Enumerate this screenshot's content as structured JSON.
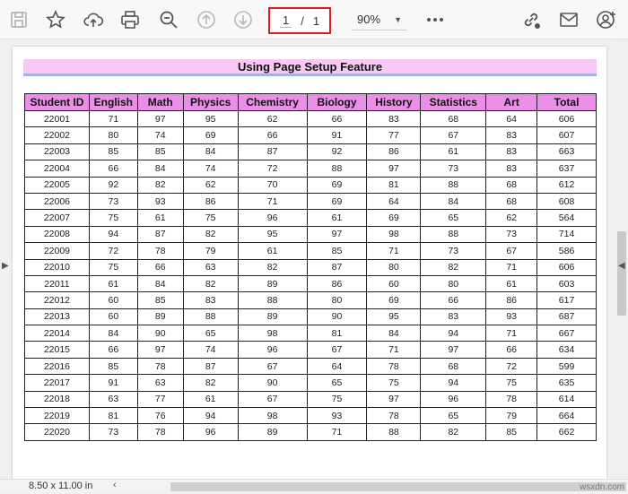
{
  "toolbar": {
    "current_page": "1",
    "page_separator": "/",
    "total_pages": "1",
    "zoom": "90%"
  },
  "document": {
    "title": "Using Page Setup Feature",
    "headers": [
      "Student ID",
      "English",
      "Math",
      "Physics",
      "Chemistry",
      "Biology",
      "History",
      "Statistics",
      "Art",
      "Total"
    ],
    "rows": [
      [
        "22001",
        "71",
        "97",
        "95",
        "62",
        "66",
        "83",
        "68",
        "64",
        "606"
      ],
      [
        "22002",
        "80",
        "74",
        "69",
        "66",
        "91",
        "77",
        "67",
        "83",
        "607"
      ],
      [
        "22003",
        "85",
        "85",
        "84",
        "87",
        "92",
        "86",
        "61",
        "83",
        "663"
      ],
      [
        "22004",
        "66",
        "84",
        "74",
        "72",
        "88",
        "97",
        "73",
        "83",
        "637"
      ],
      [
        "22005",
        "92",
        "82",
        "62",
        "70",
        "69",
        "81",
        "88",
        "68",
        "612"
      ],
      [
        "22006",
        "73",
        "93",
        "86",
        "71",
        "69",
        "64",
        "84",
        "68",
        "608"
      ],
      [
        "22007",
        "75",
        "61",
        "75",
        "96",
        "61",
        "69",
        "65",
        "62",
        "564"
      ],
      [
        "22008",
        "94",
        "87",
        "82",
        "95",
        "97",
        "98",
        "88",
        "73",
        "714"
      ],
      [
        "22009",
        "72",
        "78",
        "79",
        "61",
        "85",
        "71",
        "73",
        "67",
        "586"
      ],
      [
        "22010",
        "75",
        "66",
        "63",
        "82",
        "87",
        "80",
        "82",
        "71",
        "606"
      ],
      [
        "22011",
        "61",
        "84",
        "82",
        "89",
        "86",
        "60",
        "80",
        "61",
        "603"
      ],
      [
        "22012",
        "60",
        "85",
        "83",
        "88",
        "80",
        "69",
        "66",
        "86",
        "617"
      ],
      [
        "22013",
        "60",
        "89",
        "88",
        "89",
        "90",
        "95",
        "83",
        "93",
        "687"
      ],
      [
        "22014",
        "84",
        "90",
        "65",
        "98",
        "81",
        "84",
        "94",
        "71",
        "667"
      ],
      [
        "22015",
        "66",
        "97",
        "74",
        "96",
        "67",
        "71",
        "97",
        "66",
        "634"
      ],
      [
        "22016",
        "85",
        "78",
        "87",
        "67",
        "64",
        "78",
        "68",
        "72",
        "599"
      ],
      [
        "22017",
        "91",
        "63",
        "82",
        "90",
        "65",
        "75",
        "94",
        "75",
        "635"
      ],
      [
        "22018",
        "63",
        "77",
        "61",
        "67",
        "75",
        "97",
        "96",
        "78",
        "614"
      ],
      [
        "22019",
        "81",
        "76",
        "94",
        "98",
        "93",
        "78",
        "65",
        "79",
        "664"
      ],
      [
        "22020",
        "73",
        "78",
        "96",
        "89",
        "71",
        "88",
        "82",
        "85",
        "662"
      ]
    ]
  },
  "status": {
    "page_size": "8.50 x 11.00 in",
    "watermark": "wsxdn.com"
  },
  "icons": [
    "save-icon",
    "star-icon",
    "cloud-upload-icon",
    "print-icon",
    "zoom-out-icon",
    "page-up-icon",
    "page-down-icon",
    "more-icon",
    "link-icon",
    "email-icon",
    "account-icon"
  ],
  "colors": {
    "header_fill": "#ea8ee8",
    "title_fill": "#f9c8f4",
    "page_box_border": "#e01a22"
  }
}
